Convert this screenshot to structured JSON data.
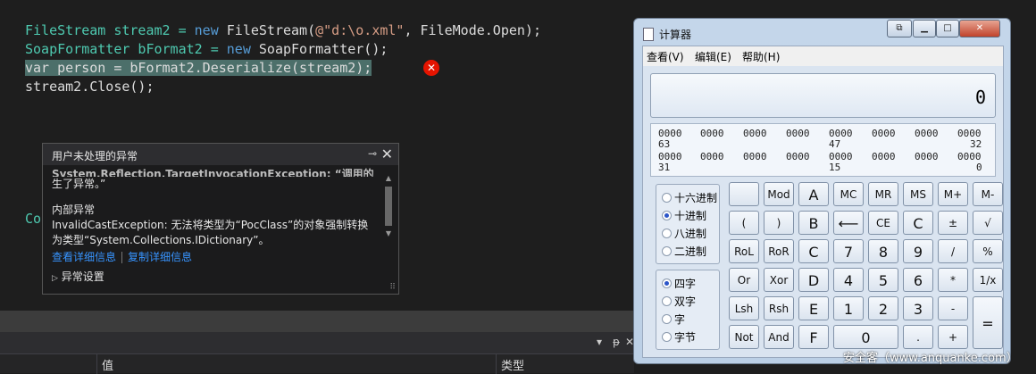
{
  "code": {
    "line1": {
      "t1": "FileStream stream2 = ",
      "kw_new": "new",
      "t2": " FileStream(",
      "str": "@\"d:\\o.xml\"",
      "t3": ", FileMode.Open);"
    },
    "line2": {
      "t1": "SoapFormatter bFormat2 = ",
      "kw_new": "new",
      "t2": " SoapFormatter();"
    },
    "line3": "var person = bFormat2.Deserialize(stream2);",
    "line4": "stream2.Close();",
    "partial": "Co"
  },
  "exception": {
    "header": "用户未处理的异常",
    "title_line": "System.Reflection.TargetInvocationException: “调用的目标发",
    "msg_cont": "生了异常。”",
    "inner_label": "内部异常",
    "inner_msg1": "InvalidCastException: 无法将类型为“PocClass”的对象强制转换",
    "inner_msg2": "为类型“System.Collections.IDictionary”。",
    "link_view": "查看详细信息",
    "link_copy": "复制详细信息",
    "settings": "异常设置"
  },
  "bottom_panel": {
    "col_value": "值",
    "col_type": "类型"
  },
  "calculator": {
    "title": "计算器",
    "menu": [
      "查看(V)",
      "编辑(E)",
      "帮助(H)"
    ],
    "display": "0",
    "bits_row1": [
      "0000",
      "0000",
      "0000",
      "0000",
      "0000",
      "0000",
      "0000",
      "0000"
    ],
    "bits_row1_labels": [
      "63",
      "47",
      "32"
    ],
    "bits_row2": [
      "0000",
      "0000",
      "0000",
      "0000",
      "0000",
      "0000",
      "0000",
      "0000"
    ],
    "bits_row2_labels": [
      "31",
      "15",
      "0"
    ],
    "base_radios": [
      "十六进制",
      "十进制",
      "八进制",
      "二进制"
    ],
    "word_radios": [
      "四字",
      "双字",
      "字",
      "字节"
    ],
    "keys": {
      "r1": [
        "",
        "Mod",
        "A",
        "MC",
        "MR",
        "MS",
        "M+",
        "M-"
      ],
      "r2": [
        "(",
        ")",
        "B",
        "⟵",
        "CE",
        "C",
        "±",
        "√"
      ],
      "r3": [
        "RoL",
        "RoR",
        "C",
        "7",
        "8",
        "9",
        "/",
        "%"
      ],
      "r4": [
        "Or",
        "Xor",
        "D",
        "4",
        "5",
        "6",
        "*",
        "1/x"
      ],
      "r5": [
        "Lsh",
        "Rsh",
        "E",
        "1",
        "2",
        "3",
        "-",
        "="
      ],
      "r6": [
        "Not",
        "And",
        "F",
        "0",
        ".",
        "+"
      ]
    }
  },
  "watermark": "安全客（www.anquanke.com）"
}
